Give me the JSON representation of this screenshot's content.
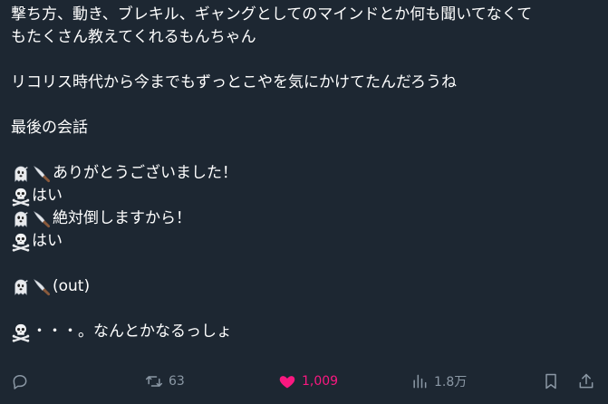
{
  "tweet": {
    "lines": [
      {
        "emoji": [],
        "text": "撃ち方、動き、ブレキル、ギャングとしてのマインドとか何も聞いてなくて"
      },
      {
        "emoji": [],
        "text": "もたくさん教えてくれるもんちゃん"
      },
      {
        "emoji": [],
        "text": ""
      },
      {
        "emoji": [],
        "text": "リコリス時代から今までもずっとこやを気にかけてたんだろうね"
      },
      {
        "emoji": [],
        "text": ""
      },
      {
        "emoji": [],
        "text": "最後の会話"
      },
      {
        "emoji": [],
        "text": ""
      },
      {
        "emoji": [
          "ghost-emoji",
          "knife-emoji"
        ],
        "text": "ありがとうございました！"
      },
      {
        "emoji": [
          "skull-crossbones-emoji"
        ],
        "text": "はい"
      },
      {
        "emoji": [
          "ghost-emoji",
          "knife-emoji"
        ],
        "text": "絶対倒しますから！"
      },
      {
        "emoji": [
          "skull-crossbones-emoji"
        ],
        "text": "はい"
      },
      {
        "emoji": [],
        "text": ""
      },
      {
        "emoji": [
          "ghost-emoji",
          "knife-emoji"
        ],
        "text": "(out)"
      },
      {
        "emoji": [],
        "text": ""
      },
      {
        "emoji": [
          "skull-crossbones-emoji"
        ],
        "text": "・・・。なんとかなるっしょ"
      }
    ]
  },
  "actions": {
    "reply": {
      "icon": "reply-icon",
      "count": ""
    },
    "retweet": {
      "icon": "retweet-icon",
      "count": "63"
    },
    "like": {
      "icon": "heart-icon",
      "count": "1,009",
      "liked": true
    },
    "views": {
      "icon": "views-icon",
      "count": "1.8万"
    },
    "bookmark": {
      "icon": "bookmark-icon"
    },
    "share": {
      "icon": "share-icon"
    }
  },
  "colors": {
    "background": "#1d2732",
    "text": "#ffffff",
    "muted": "#8b98a5",
    "like": "#f91880"
  }
}
